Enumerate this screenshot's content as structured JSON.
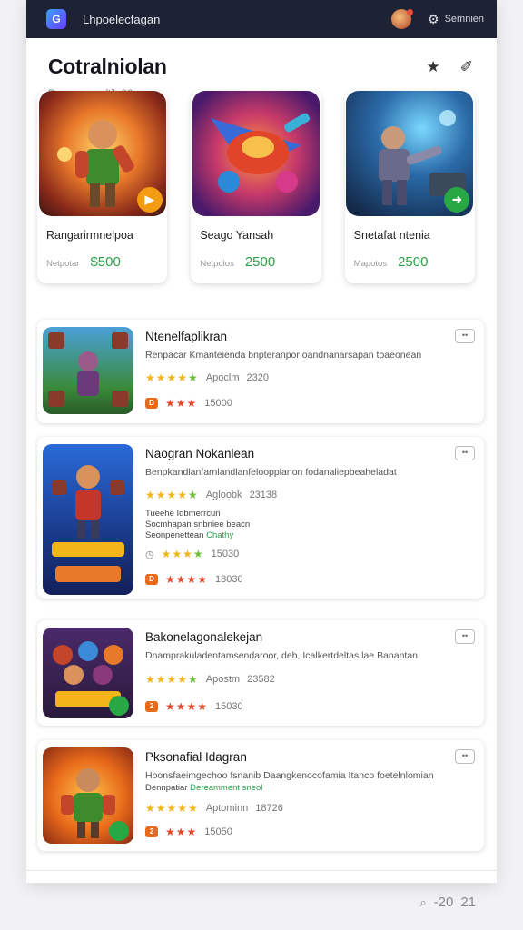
{
  "topbar": {
    "logo_text": "G",
    "title": "Lhpoelecfagan",
    "settings_label": "Semnien"
  },
  "header": {
    "title": "Cotralniolan",
    "subtitle": "Renpaeaan dtib 06",
    "icons": [
      "star-icon",
      "pin-icon"
    ]
  },
  "featured": [
    {
      "name": "Rangarirmnelpoa",
      "sub": "Netpotar",
      "price": "$500",
      "badge_color": "#f39c12"
    },
    {
      "name": "Seago Yansah",
      "sub": "Netpolos",
      "price": "2500",
      "badge_color": "#27a844"
    },
    {
      "name": "Snetafat ntenia",
      "sub": "Mapotos",
      "price": "2500",
      "badge_color": "#27a844"
    }
  ],
  "apps": [
    {
      "title": "Ntenelfaplikran",
      "desc": "Renpacar Kmanteienda bnpteranpor oandnanarsapan toaeonean",
      "rating_label": "Apoclm",
      "rating_count": "2320",
      "rating2_badge": "D",
      "rating2_count": "15000",
      "more": "••"
    },
    {
      "title": "Naogran Nokanlean",
      "desc": "Benpkandlanfarnlandlanfeloopplanon fodanaliepbeaheladat",
      "rating_label": "Agloobk",
      "rating_count": "23138",
      "extra1": "Tueehe Idbmerrcun",
      "extra2": "Socmhapan snbniee beacn",
      "extra3_a": "Seonpenettean",
      "extra3_b": "Chathy",
      "rating3_count": "15030",
      "rating2_badge": "D",
      "rating2_count": "18030",
      "more": "••"
    },
    {
      "title": "Bakonelagonalekejan",
      "desc": "Dnamprakuladentamsendaroor, deb, Icalkertdeltas lae Banantan",
      "rating_label": "Apostm",
      "rating_count": "23582",
      "rating2_badge": "2",
      "rating2_count": "15030",
      "more": "••"
    },
    {
      "title": "Pksonafial Idagran",
      "desc": "Hoonsfaeimgechoo fsnanib Daangkenocofamia Itanco foetelnlomian",
      "extra_a": "Dennpatiar",
      "extra_b": "Dereamment",
      "extra_c": "sneol",
      "rating_label": "Aptominn",
      "rating_count": "18726",
      "rating2_badge": "2",
      "rating2_count": "15050",
      "more": "••"
    }
  ],
  "footer": {
    "icon": "search-icon",
    "left": "-20",
    "right": "21"
  }
}
